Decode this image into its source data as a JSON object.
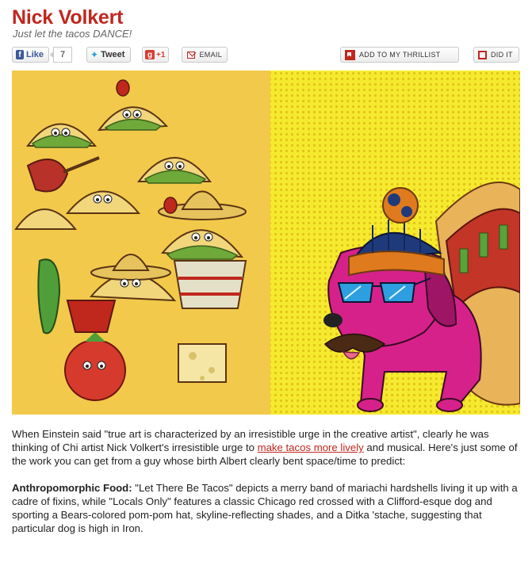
{
  "article": {
    "title": "Nick Volkert",
    "subtitle": "Just let the tacos DANCE!"
  },
  "share": {
    "facebook_label": "Like",
    "facebook_count": "7",
    "tweet_label": "Tweet",
    "gplus_label": "+1",
    "email_label": "EMAIL",
    "thrillist_label": "ADD TO MY THRILLIST",
    "did_it_label": "DID IT"
  },
  "image": {
    "left_caption": "Let There Be Tacos",
    "right_caption": "Locals Only"
  },
  "body": {
    "p1_before": "When Einstein said \"true art is characterized by an irresistible urge in the creative artist\", clearly he was thinking of Chi artist Nick Volkert's irresistible urge to ",
    "p1_link": "make tacos more lively",
    "p1_after": " and musical. Here's just some of the work you can get from a guy whose birth Albert clearly bent space/time to predict:",
    "p2_heading": "Anthropomorphic Food:",
    "p2_text": " \"Let There Be Tacos\" depicts a merry band of mariachi hardshells living it up with a cadre of fixins, while \"Locals Only\" features a classic Chicago red crossed with a Clifford-esque dog and sporting a Bears-colored pom-pom hat, skyline-reflecting shades, and a Ditka 'stache, suggesting that particular dog is high in Iron."
  },
  "colors": {
    "brand_red": "#c0271d",
    "taco_yellow": "#f2c94a",
    "pop_yellow": "#f6ea2e",
    "dog_magenta": "#d6218a"
  }
}
